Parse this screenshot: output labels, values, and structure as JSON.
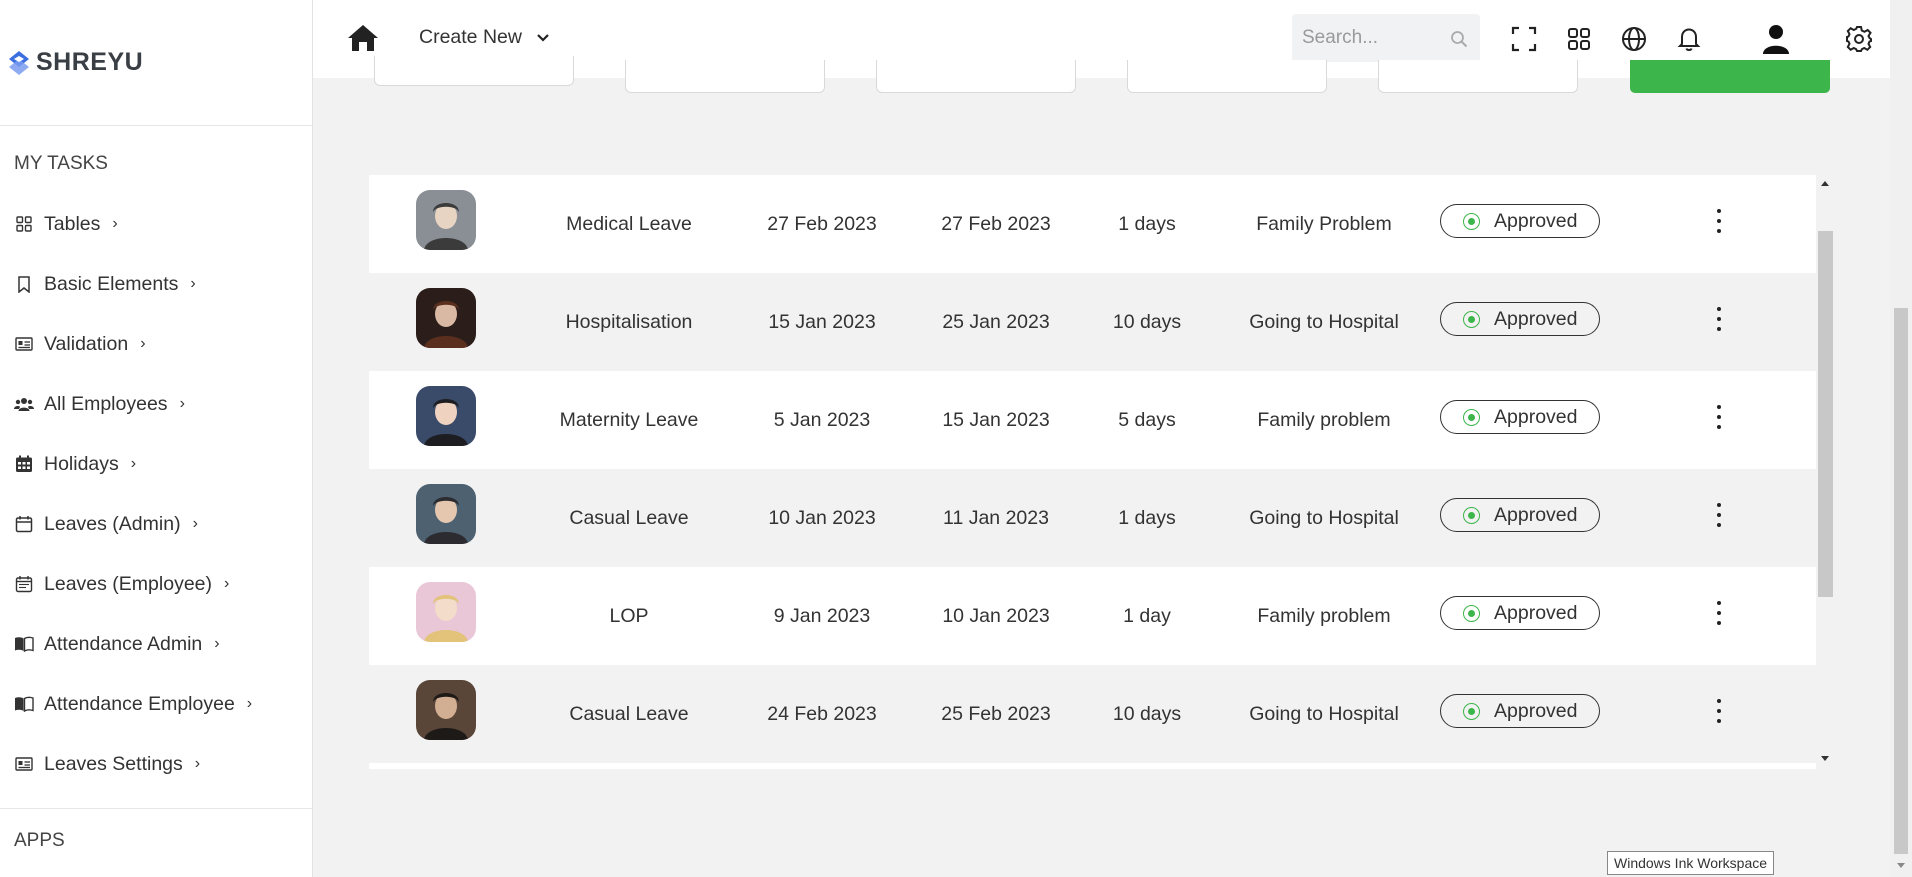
{
  "brand": {
    "name": "SHREYU"
  },
  "sidebar": {
    "tasks_title": "MY TASKS",
    "items": [
      {
        "label": "Tables",
        "icon": "grid-icon"
      },
      {
        "label": "Basic Elements",
        "icon": "bookmark-icon"
      },
      {
        "label": "Validation",
        "icon": "id-card-icon"
      },
      {
        "label": "All Employees",
        "icon": "users-icon"
      },
      {
        "label": "Holidays",
        "icon": "calendar-grid-icon"
      },
      {
        "label": "Leaves (Admin)",
        "icon": "calendar-icon"
      },
      {
        "label": "Leaves (Employee)",
        "icon": "calendar-lines-icon"
      },
      {
        "label": "Attendance Admin",
        "icon": "book-open-icon"
      },
      {
        "label": "Attendance Employee",
        "icon": "book-open-icon"
      },
      {
        "label": "Leaves Settings",
        "icon": "id-card-icon"
      }
    ],
    "apps_title": "APPS"
  },
  "topbar": {
    "create_new": "Create New",
    "search_placeholder": "Search..."
  },
  "colors": {
    "accent_green": "#3cb54a",
    "status_green": "#3cb54a"
  },
  "leaves": {
    "rows": [
      {
        "leave_type": "Medical Leave",
        "from": "27 Feb 2023",
        "to": "27 Feb 2023",
        "days": "1 days",
        "reason": "Family Problem",
        "status": "Approved"
      },
      {
        "leave_type": "Hospitalisation",
        "from": "15 Jan 2023",
        "to": "25 Jan 2023",
        "days": "10 days",
        "reason": "Going to Hospital",
        "status": "Approved"
      },
      {
        "leave_type": "Maternity Leave",
        "from": "5 Jan 2023",
        "to": "15 Jan 2023",
        "days": "5 days",
        "reason": "Family problem",
        "status": "Approved"
      },
      {
        "leave_type": "Casual Leave",
        "from": "10 Jan 2023",
        "to": "11 Jan 2023",
        "days": "1 days",
        "reason": "Going to Hospital",
        "status": "Approved"
      },
      {
        "leave_type": "LOP",
        "from": "9 Jan 2023",
        "to": "10 Jan 2023",
        "days": "1 day",
        "reason": "Family problem",
        "status": "Approved"
      },
      {
        "leave_type": "Casual Leave",
        "from": "24 Feb 2023",
        "to": "25 Feb 2023",
        "days": "10 days",
        "reason": "Going to Hospital",
        "status": "Approved"
      }
    ]
  },
  "tooltip": "Windows Ink Workspace"
}
